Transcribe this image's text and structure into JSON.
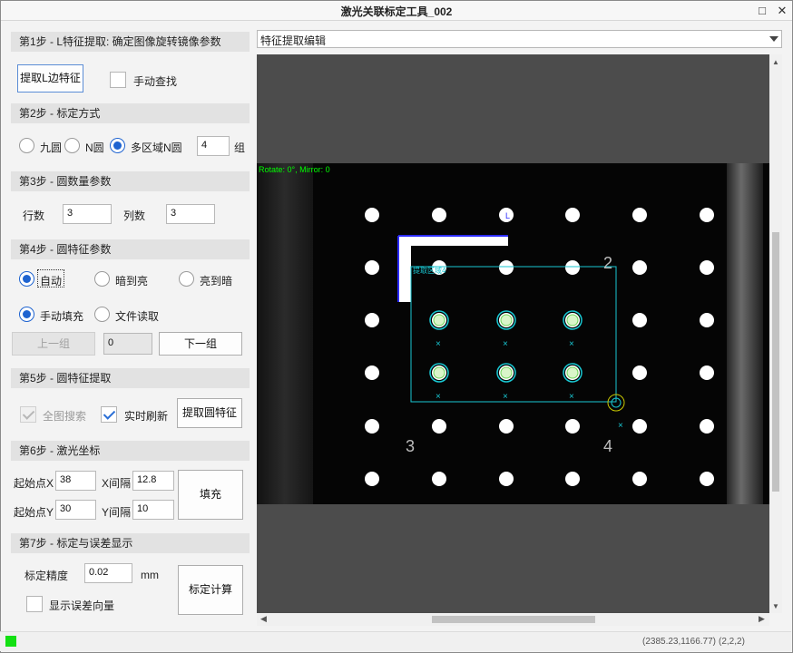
{
  "window": {
    "title": "激光关联标定工具_002",
    "maximize_icon": "□",
    "close_icon": "✕"
  },
  "step1": {
    "header": "第1步 - L特征提取: 确定图像旋转镜像参数",
    "extract_button": "提取L边特征",
    "manual_label": "手动查找",
    "manual_checked": false
  },
  "step2": {
    "header": "第2步 - 标定方式",
    "options": [
      "九圆",
      "N圆",
      "多区域N圆"
    ],
    "selected": "多区域N圆",
    "groups_value": "4",
    "groups_unit": "组"
  },
  "step3": {
    "header": "第3步 - 圆数量参数",
    "rows_label": "行数",
    "rows_value": "3",
    "cols_label": "列数",
    "cols_value": "3"
  },
  "step4": {
    "header": "第4步 - 圆特征参数",
    "polarity_options": [
      "自动",
      "暗到亮",
      "亮到暗"
    ],
    "polarity_selected": "自动",
    "source_options": [
      "手动填充",
      "文件读取"
    ],
    "source_selected": "手动填充",
    "prev_button": "上一组",
    "group_index": "0",
    "next_button": "下一组"
  },
  "step5": {
    "header": "第5步 - 圆特征提取",
    "full_search_label": "全图搜索",
    "full_search_checked": true,
    "realtime_label": "实时刷新",
    "realtime_checked": true,
    "extract_button": "提取圆特征"
  },
  "step6": {
    "header": "第6步 - 激光坐标",
    "start_x_label": "起始点X",
    "start_x_value": "38",
    "x_interval_label": "X间隔",
    "x_interval_value": "12.8",
    "start_y_label": "起始点Y",
    "start_y_value": "30",
    "y_interval_label": "Y间隔",
    "y_interval_value": "10",
    "fill_button": "填充"
  },
  "step7": {
    "header": "第7步 - 标定与误差显示",
    "precision_label": "标定精度",
    "precision_value": "0.02",
    "precision_unit": "mm",
    "show_error_label": "显示误差向量",
    "show_error_checked": false,
    "calc_button": "标定计算"
  },
  "viewer": {
    "mode_selected": "特征提取编辑",
    "overlay_text": "Rotate: 0°, Mirror: 0",
    "region_labels": [
      "2",
      "3",
      "4"
    ],
    "roi_caption": "提取区域4",
    "l_label": "L",
    "colors": {
      "overlay": "#00ff00",
      "roi": "#19c7d2",
      "l_marker": "#2b2bff"
    }
  },
  "status": {
    "led_color": "#13e013",
    "coords": "(2385.23,1166.77)",
    "grid_index": "(2,2,2)"
  }
}
